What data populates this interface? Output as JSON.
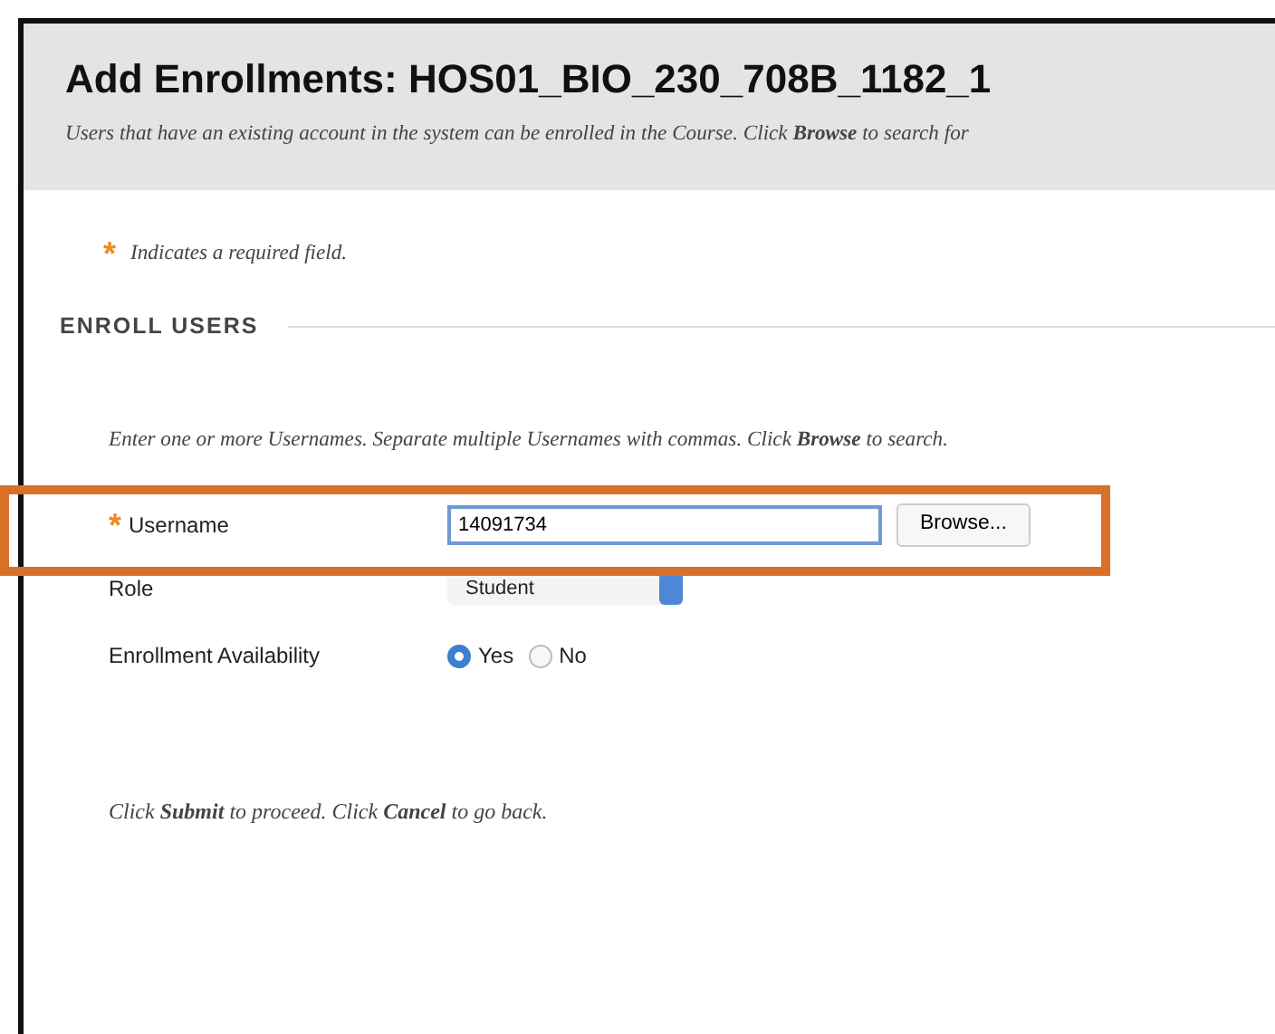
{
  "header": {
    "title": "Add Enrollments: HOS01_BIO_230_708B_1182_1",
    "description": "Users that have an existing account in the system can be enrolled in the Course. Click **Browse** to search for"
  },
  "required_note": {
    "marker": "*",
    "text": "Indicates a required field."
  },
  "section": {
    "title": "ENROLL USERS",
    "instructions": "Enter one or more Usernames. Separate multiple Usernames with commas. Click **Browse** to search."
  },
  "fields": [
    {
      "kind": "text",
      "label": "Username",
      "required": true,
      "marker": "*",
      "value": "14091734",
      "focused": true,
      "button": "Browse...",
      "highlighted": true
    },
    {
      "kind": "select",
      "label": "Role",
      "required": false,
      "value": "Student"
    },
    {
      "kind": "radio",
      "label": "Enrollment Availability",
      "required": false,
      "options": [
        {
          "label": "Yes",
          "selected": true
        },
        {
          "label": "No",
          "selected": false
        }
      ]
    }
  ],
  "footer_note": "Click **Submit** to proceed. Click **Cancel** to go back."
}
